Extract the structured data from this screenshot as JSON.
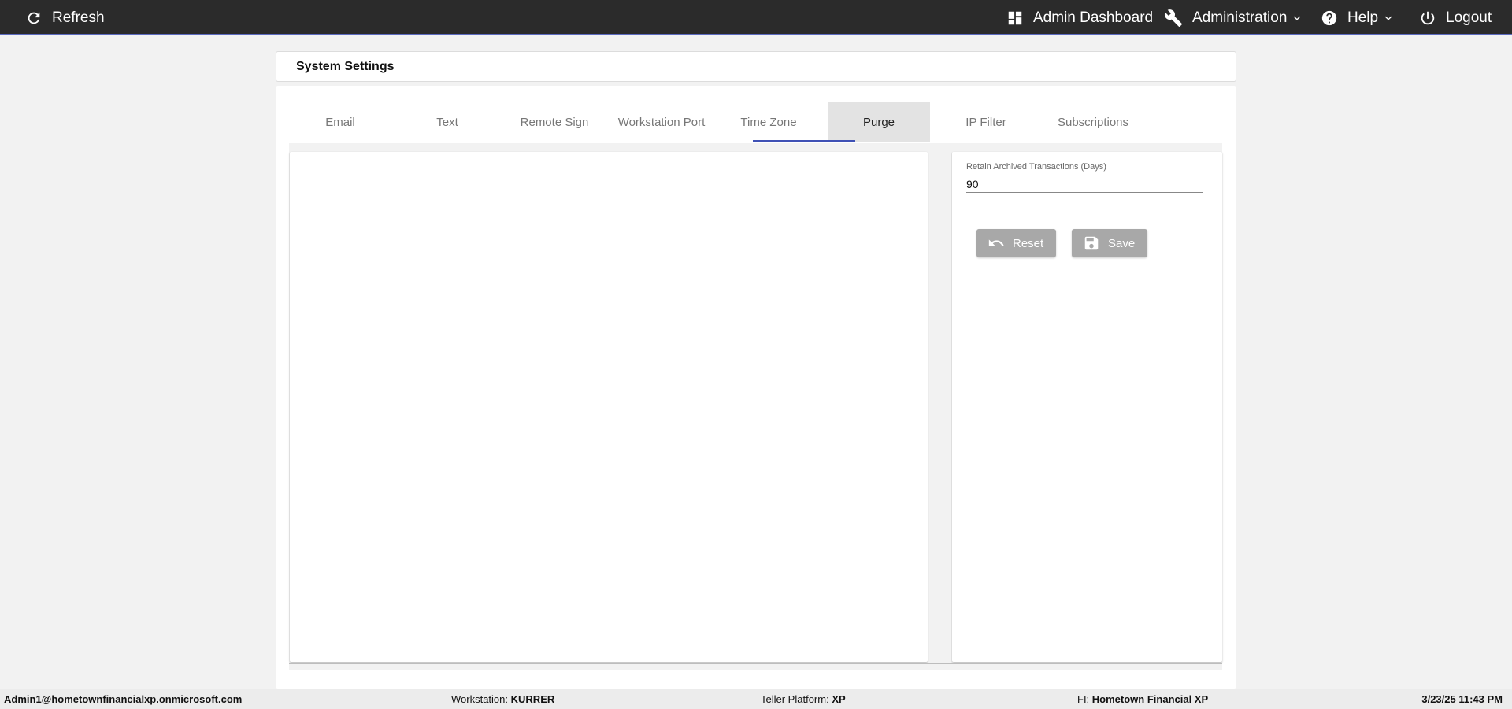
{
  "topbar": {
    "refresh_label": "Refresh",
    "dashboard_label": "Admin Dashboard",
    "administration_label": "Administration",
    "help_label": "Help",
    "logout_label": "Logout"
  },
  "page": {
    "title": "System Settings"
  },
  "tabs": [
    {
      "label": "Email"
    },
    {
      "label": "Text"
    },
    {
      "label": "Remote Sign"
    },
    {
      "label": "Workstation Port"
    },
    {
      "label": "Time Zone"
    },
    {
      "label": "Purge"
    },
    {
      "label": "IP Filter"
    },
    {
      "label": "Subscriptions"
    }
  ],
  "purge": {
    "retain_label": "Retain Archived Transactions (Days)",
    "retain_value": "90",
    "reset_label": "Reset",
    "save_label": "Save"
  },
  "status": {
    "user": "Admin1@hometownfinancialxp.onmicrosoft.com",
    "workstation_label": "Workstation:",
    "workstation_value": "KURRER",
    "platform_label": "Teller Platform:",
    "platform_value": "XP",
    "fi_label": "FI:",
    "fi_value": "Hometown Financial XP",
    "datetime": "3/23/25 11:43 PM"
  },
  "colors": {
    "topbar": "#2b2b2b",
    "accent": "#3f51b5",
    "button_disabled": "#a8a8a8"
  }
}
